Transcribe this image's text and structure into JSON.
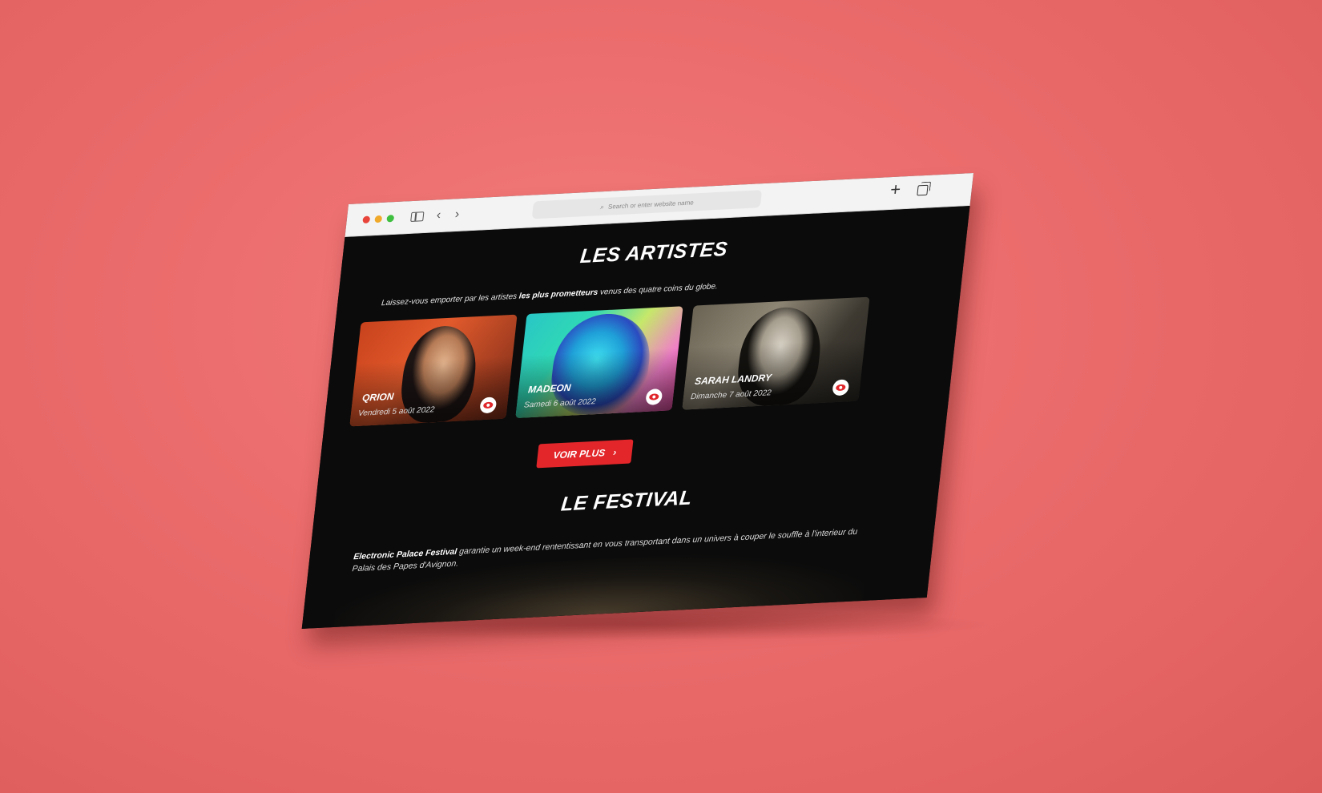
{
  "browser": {
    "address_placeholder": "Search or enter website name",
    "icons": [
      "sidebar-icon",
      "back-icon",
      "forward-icon",
      "new-tab-icon",
      "tabs-icon"
    ]
  },
  "artists": {
    "title": "LES ARTISTES",
    "intro_prefix": "Laissez-vous emporter par les artistes ",
    "intro_bold": "les plus prometteurs",
    "intro_suffix": " venus des quatre coins du globe.",
    "cards": [
      {
        "name": "QRION",
        "date": "Vendredi 5 août 2022"
      },
      {
        "name": "MADEON",
        "date": "Samedi 6 août 2022"
      },
      {
        "name": "SARAH LANDRY",
        "date": "Dimanche 7 août 2022"
      }
    ],
    "cta_label": "VOIR PLUS",
    "cta_icon": "›"
  },
  "festival": {
    "title": "LE FESTIVAL",
    "text_bold": "Electronic Palace Festival",
    "text_rest": " garantie un week-end rententissant en vous transportant dans un univers à couper le souffle à l'interieur du Palais des Papes d'Avignon."
  },
  "colors": {
    "background": "#ec6d6d",
    "accent": "#e2262a",
    "page": "#0b0b0b"
  }
}
